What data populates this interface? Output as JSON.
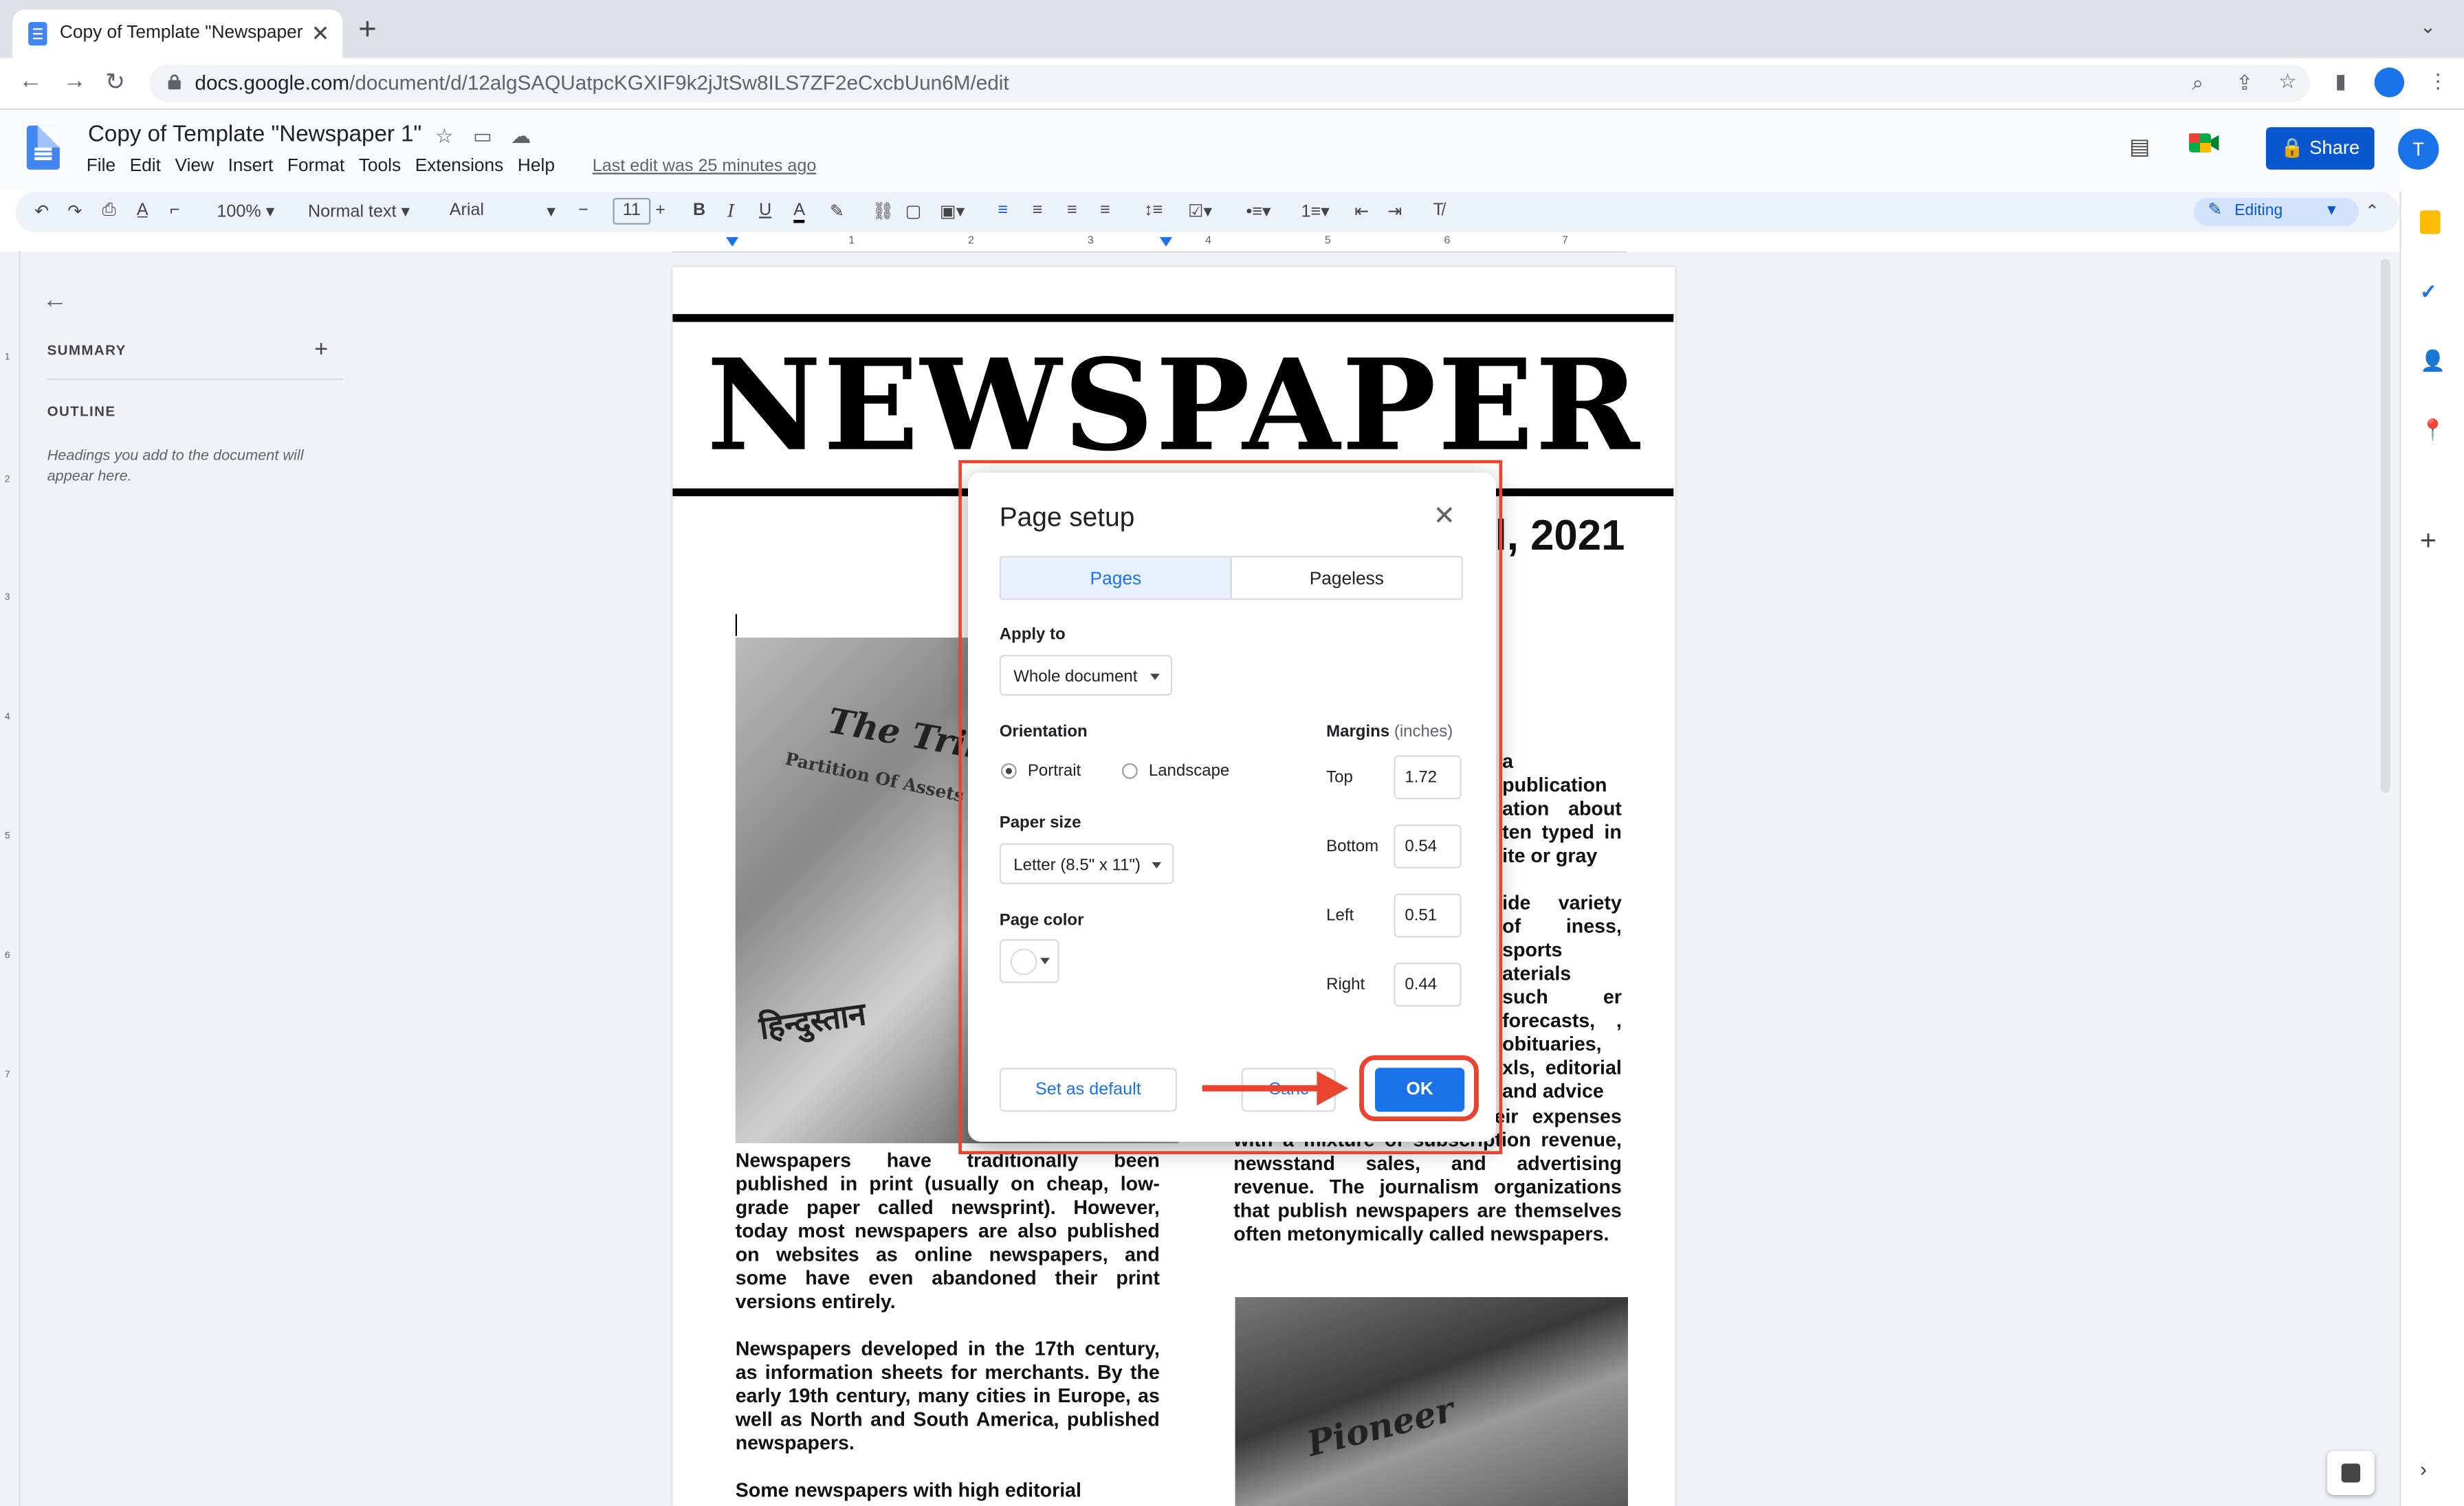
{
  "browser": {
    "tab_title": "Copy of Template \"Newspaper",
    "url_host": "docs.google.com",
    "url_path": "/document/d/12algSAQUatpcKGXIF9k2jJtSw8ILS7ZF2eCxcbUun6M/edit"
  },
  "docs": {
    "title": "Copy of Template \"Newspaper 1\"",
    "menu": [
      "File",
      "Edit",
      "View",
      "Insert",
      "Format",
      "Tools",
      "Extensions",
      "Help"
    ],
    "last_edit": "Last edit was 25 minutes ago",
    "share_label": "Share",
    "avatar_initial": "T",
    "toolbar": {
      "zoom": "100%",
      "style": "Normal text",
      "font": "Arial",
      "font_size": "11",
      "mode": "Editing"
    },
    "ruler_marks": [
      "1",
      "2",
      "3",
      "4",
      "5",
      "6",
      "7"
    ]
  },
  "sidebar": {
    "summary_label": "SUMMARY",
    "outline_label": "OUTLINE",
    "outline_hint": "Headings you add to the document will appear here."
  },
  "document": {
    "masthead": "NEWSPAPER",
    "date_fragment": "l, 2021",
    "photo1_caption": "The Tribun",
    "photo1_sub": "Partition Of Assets And Lia",
    "photo1_hindi": "हिन्दुस्तान",
    "photo2_caption": "Pioneer",
    "col_left_1": "Newspapers have traditionally been published in print (usually on cheap, low-grade paper called newsprint). However, today most newspapers are also published on websites as online newspapers, and some have even abandoned their print versions entirely.",
    "col_left_2": "Newspapers developed in the 17th century, as information sheets for merchants. By the early 19th century, many cities in Europe, as well as North and South America, published newspapers.",
    "col_left_3": "Some newspapers with high editorial",
    "col_right_1": "a publication ation about ten typed in ite or gray",
    "col_right_2": "ide variety of iness, sports aterials such er forecasts, , obituaries, xls, editorial and advice",
    "col_right_3": "inesses, and they pay their expenses with a mixture of subscription revenue, newsstand sales, and advertising revenue. The journalism organizations that publish newspapers are themselves often metonymically called newspapers."
  },
  "dialog": {
    "title": "Page setup",
    "tab_pages": "Pages",
    "tab_pageless": "Pageless",
    "apply_to_label": "Apply to",
    "apply_to_value": "Whole document",
    "orientation_label": "Orientation",
    "portrait": "Portrait",
    "landscape": "Landscape",
    "paper_size_label": "Paper size",
    "paper_size_value": "Letter (8.5\" x 11\")",
    "page_color_label": "Page color",
    "margins_label": "Margins",
    "margins_unit": "(inches)",
    "margin_top_label": "Top",
    "margin_top": "1.72",
    "margin_bottom_label": "Bottom",
    "margin_bottom": "0.54",
    "margin_left_label": "Left",
    "margin_left": "0.51",
    "margin_right_label": "Right",
    "margin_right": "0.44",
    "set_default": "Set as default",
    "cancel": "Canc",
    "ok": "OK"
  },
  "colors": {
    "accent": "#1a73e8",
    "share": "#0b57d0",
    "annotation": "#e8442e"
  }
}
